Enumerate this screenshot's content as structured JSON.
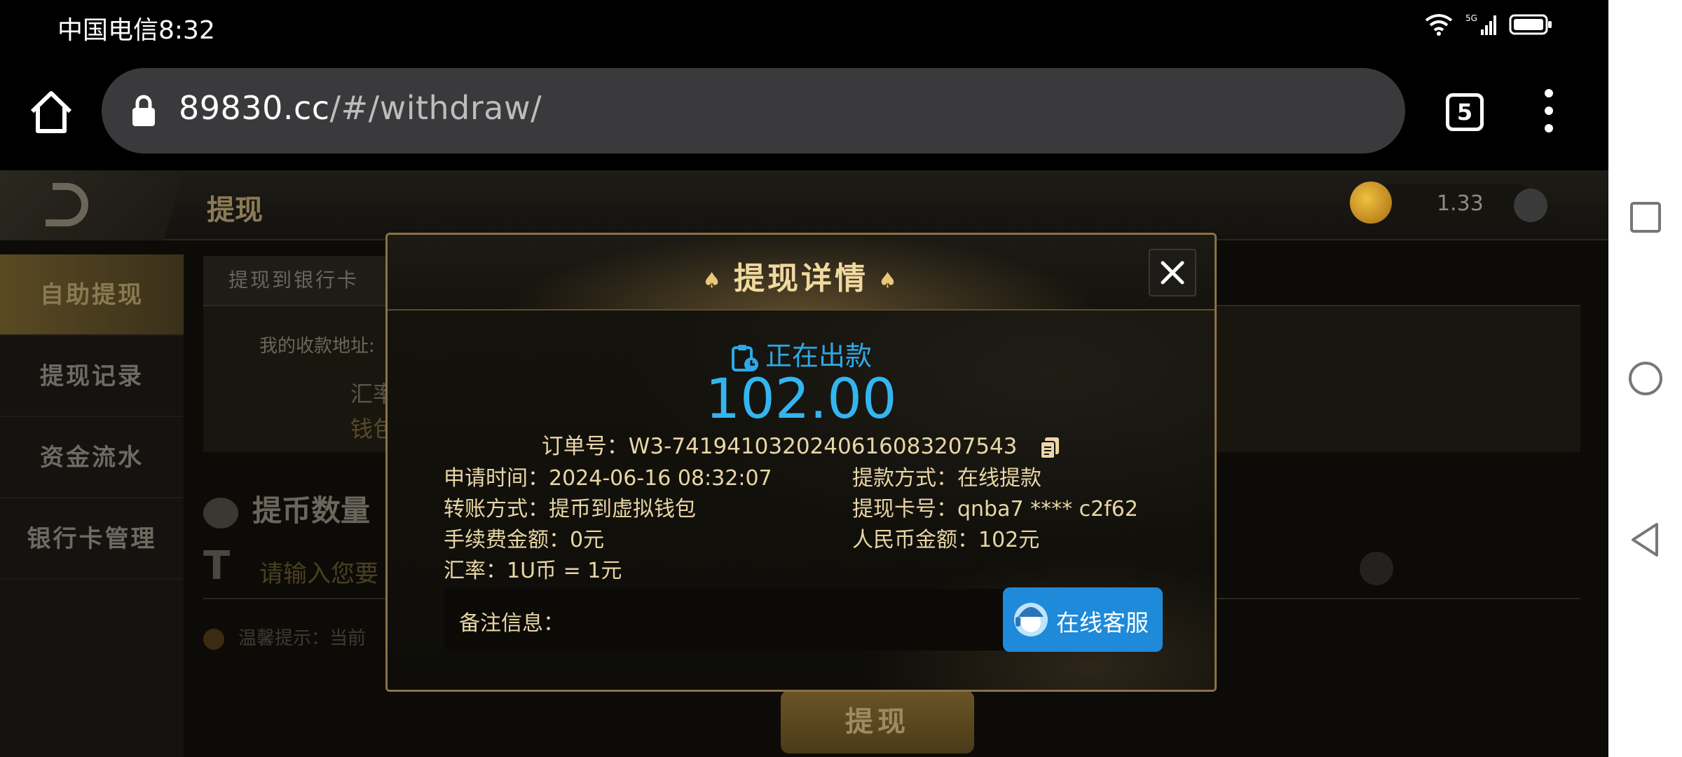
{
  "status_bar": {
    "carrier_time": "中国电信8:32",
    "network": "5G"
  },
  "browser": {
    "url_host": "89830.cc",
    "url_path": "/#/withdraw/",
    "tab_count": "5"
  },
  "page": {
    "title": "提现",
    "balance": "1.33",
    "sidebar": [
      {
        "label": "自助提现",
        "active": true
      },
      {
        "label": "提现记录",
        "active": false
      },
      {
        "label": "资金流水",
        "active": false
      },
      {
        "label": "银行卡管理",
        "active": false
      }
    ],
    "tab_bank": "提现到银行卡",
    "address_label": "我的收款地址:",
    "rate_fragment": "汇率",
    "wallet_fragment": "钱包",
    "amount_heading": "提币数量",
    "amount_placeholder": "请输入您要",
    "tip_fragment": "温馨提示：当前",
    "submit_label": "提现"
  },
  "modal": {
    "title": "提现详情",
    "status": "正在出款",
    "amount": "102.00",
    "order_label": "订单号：",
    "order_no": "W3-741941032024061608320754З",
    "apply_time_label": "申请时间：",
    "apply_time": "2024-06-16 08:32:07",
    "method_label": "提款方式：",
    "method": "在线提款",
    "transfer_label": "转账方式：",
    "transfer": "提币到虚拟钱包",
    "card_label": "提现卡号：",
    "card": "qnba7 **** c2f62",
    "fee_label": "手续费金额：",
    "fee": "0元",
    "rmb_label": "人民币金额：",
    "rmb": "102元",
    "rate_label": "汇率：",
    "rate": "1U币 = 1元",
    "remark_label": "备注信息：",
    "cs_label": "在线客服"
  },
  "colors": {
    "accent_blue": "#33b6ef",
    "gold_text": "#e9d6a6",
    "modal_border": "#8b7245",
    "cs_button": "#1e8ad9"
  }
}
